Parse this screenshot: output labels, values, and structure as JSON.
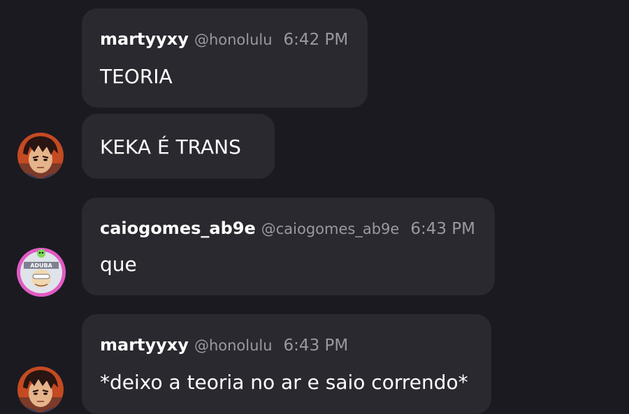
{
  "messages": [
    {
      "username": "martyyxy",
      "handle": "@honolulu",
      "time": "6:42 PM",
      "text": "TEORIA",
      "avatar": "anime-character-avatar"
    },
    {
      "text": "KEKA É TRANS",
      "avatar": "anime-character-avatar"
    },
    {
      "username": "caiogomes_ab9e",
      "handle": "@caiogomes_ab9e",
      "time": "6:43 PM",
      "text": "que",
      "avatar": "cartoon-character-avatar",
      "avatar_ring_color": "#e05bc3",
      "avatar_badge_color": "#7cd957",
      "avatar_badge_text": "ADUBA"
    },
    {
      "username": "martyyxy",
      "handle": "@honolulu",
      "time": "6:43 PM",
      "text": "*deixo a teoria no ar e saio correndo*",
      "avatar": "anime-character-avatar"
    }
  ],
  "colors": {
    "background": "#1b1a21",
    "bubble": "#2a2930",
    "meta_text": "#9a98a3"
  }
}
